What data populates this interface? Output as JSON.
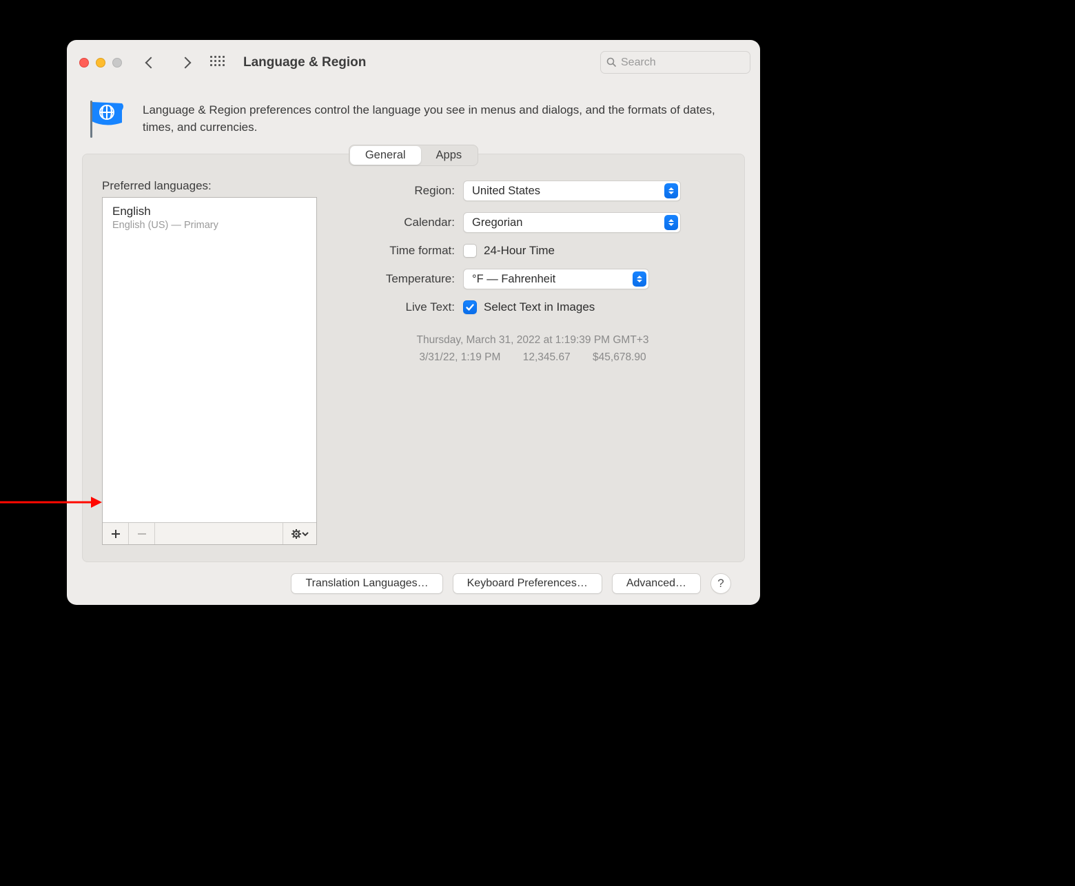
{
  "window": {
    "title": "Language & Region"
  },
  "search": {
    "placeholder": "Search"
  },
  "intro": {
    "text": "Language & Region preferences control the language you see in menus and dialogs, and the formats of dates, times, and currencies."
  },
  "tabs": {
    "general": "General",
    "apps": "Apps"
  },
  "left": {
    "preferred_languages_label": "Preferred languages:",
    "languages": [
      {
        "name": "English",
        "detail": "English (US) — Primary"
      }
    ]
  },
  "form": {
    "region_label": "Region:",
    "region_value": "United States",
    "calendar_label": "Calendar:",
    "calendar_value": "Gregorian",
    "time_format_label": "Time format:",
    "time_format_value": "24-Hour Time",
    "temperature_label": "Temperature:",
    "temperature_value": "°F — Fahrenheit",
    "live_text_label": "Live Text:",
    "live_text_value": "Select Text in Images"
  },
  "example": {
    "line1": "Thursday, March 31, 2022 at 1:19:39 PM GMT+3",
    "date_short": "3/31/22, 1:19 PM",
    "number": "12,345.67",
    "currency": "$45,678.90"
  },
  "footer": {
    "translation": "Translation Languages…",
    "keyboard": "Keyboard Preferences…",
    "advanced": "Advanced…",
    "help": "?"
  },
  "colors": {
    "accent": "#0a7cff"
  }
}
